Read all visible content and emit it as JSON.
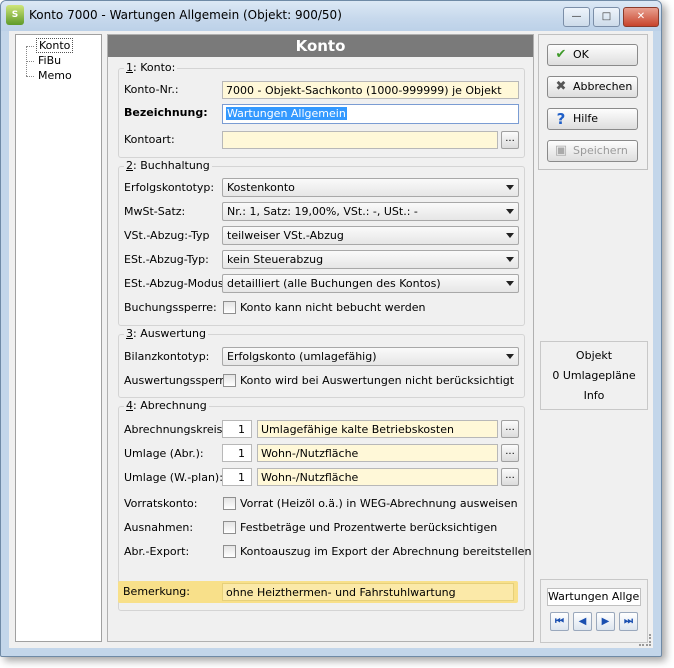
{
  "window": {
    "title": "Konto 7000 - Wartungen Allgemein  (Objekt: 900/50)",
    "app_icon": "S"
  },
  "tree": [
    "Konto",
    "FiBu",
    "Memo"
  ],
  "panel_title": "Konto",
  "konto": {
    "group_num": "1",
    "group_rest": ": Konto:",
    "nr_label": "Konto-Nr.:",
    "nr_value": "7000 - Objekt-Sachkonto (1000-999999) je Objekt",
    "bez_label": "Bezeichnung:",
    "bez_value": "Wartungen Allgemein",
    "art_label": "Kontoart:",
    "art_value": "",
    "dots": "..."
  },
  "buchhaltung": {
    "group_num": "2",
    "group_rest": ": Buchhaltung",
    "rows": [
      {
        "label": "Erfolgskontotyp:",
        "value": "Kostenkonto"
      },
      {
        "label": "MwSt-Satz:",
        "value": "Nr.: 1,  Satz: 19,00%,  VSt.: -,  USt.: -"
      },
      {
        "label": "VSt.-Abzug:-Typ",
        "value": "teilweiser VSt.-Abzug"
      },
      {
        "label": "ESt.-Abzug-Typ:",
        "value": "kein Steuerabzug"
      },
      {
        "label": "ESt.-Abzug-Modus:",
        "value": "detailliert (alle Buchungen des Kontos)"
      }
    ],
    "sperre_label": "Buchungssperre:",
    "sperre_text": "Konto kann nicht bebucht werden"
  },
  "auswertung": {
    "group_num": "3",
    "group_rest": ": Auswertung",
    "bilanz_label": "Bilanzkontotyp:",
    "bilanz_value": "Erfolgskonto (umlagefähig)",
    "sperre_label": "Auswertungssperre:",
    "sperre_text": "Konto wird bei Auswertungen nicht berücksichtigt"
  },
  "abrechnung": {
    "group_num": "4",
    "group_rest": ": Abrechnung",
    "rows": [
      {
        "label": "Abrechnungskreis:",
        "num": "1",
        "value": "Umlagefähige kalte Betriebskosten"
      },
      {
        "label": "Umlage (Abr.):",
        "num": "1",
        "value": "Wohn-/Nutzfläche"
      },
      {
        "label": "Umlage (W.-plan):",
        "num": "1",
        "value": "Wohn-/Nutzfläche"
      }
    ],
    "checks": [
      {
        "label": "Vorratskonto:",
        "text": "Vorrat (Heizöl o.ä.) in WEG-Abrechnung ausweisen"
      },
      {
        "label": "Ausnahmen:",
        "text": "Festbeträge und Prozentwerte berücksichtigen"
      },
      {
        "label": "Abr.-Export:",
        "text": "Kontoauszug im Export der Abrechnung bereitstellen"
      }
    ],
    "bemerkung_label": "Bemerkung:",
    "bemerkung_value": "ohne Heizthermen- und Fahrstuhlwartung"
  },
  "buttons": {
    "ok": "OK",
    "abbrechen": "Abbrechen",
    "hilfe": "Hilfe",
    "speichern": "Speichern"
  },
  "info": [
    "Objekt",
    "0 Umlagepläne",
    "Info"
  ],
  "nav": {
    "record": "Wartungen Allgem",
    "first": "⏮",
    "prev": "◀",
    "next": "▶",
    "last": "⏭"
  },
  "colors": {
    "field_yellow": "#fff8d8",
    "highlight_row": "#f8e08a",
    "panel_header": "#7a7a7a",
    "selection_blue": "#3399ff"
  }
}
